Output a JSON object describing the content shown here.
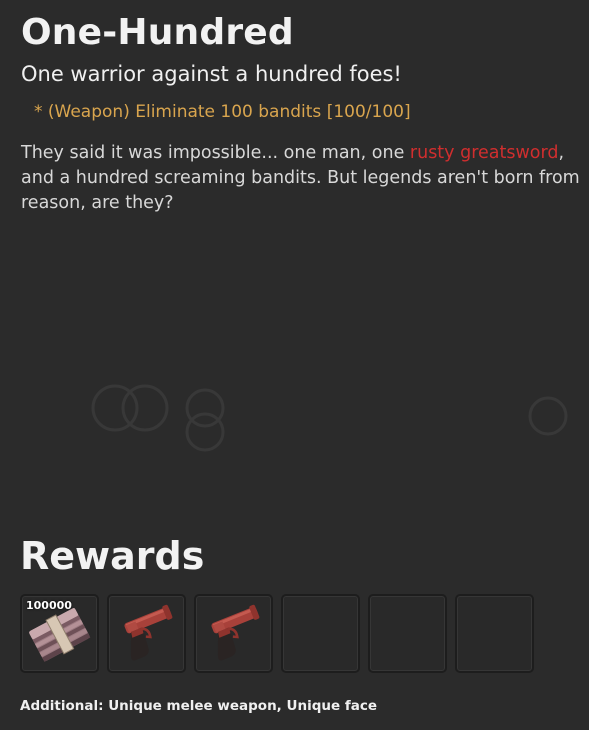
{
  "quest": {
    "title": "One-Hundred",
    "subtitle": "One warrior against a hundred foes!",
    "objective": "* (Weapon) Eliminate 100 bandits [100/100]",
    "description": {
      "part1": "They said it was impossible... one man, one ",
      "highlight": "rusty greatsword",
      "part2": ", and a hundred screaming bandits. But legends aren't born from reason, are they?"
    }
  },
  "rewards": {
    "heading": "Rewards",
    "items": [
      {
        "icon": "cash-bundle-icon",
        "count": "100000"
      },
      {
        "icon": "flare-gun-icon",
        "count": ""
      },
      {
        "icon": "flare-gun-icon",
        "count": ""
      },
      {
        "icon": "",
        "count": ""
      },
      {
        "icon": "",
        "count": ""
      },
      {
        "icon": "",
        "count": ""
      }
    ],
    "additional": "Additional: Unique melee weapon, Unique face"
  },
  "colors": {
    "background": "#2b2b2b",
    "objective": "#d9a54e",
    "highlight": "#d02e2e"
  }
}
